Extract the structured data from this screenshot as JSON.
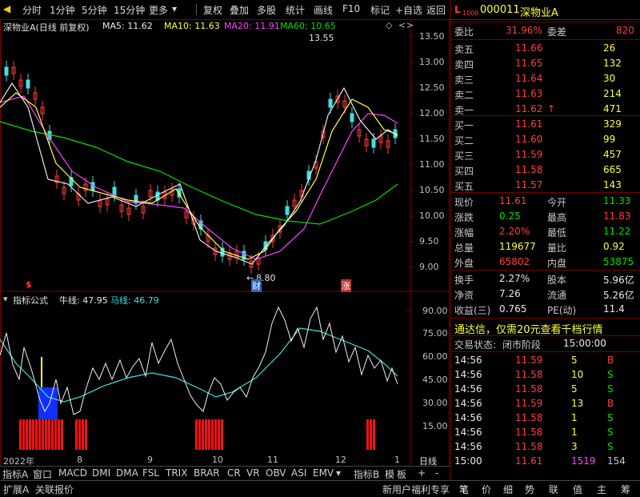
{
  "toolbar": {
    "items": [
      "分时",
      "1分钟",
      "5分钟",
      "15分钟",
      "更多",
      "复权",
      "叠加",
      "多股",
      "统计",
      "画线",
      "F10",
      "标记",
      "+自选",
      "返回"
    ]
  },
  "chart_header": {
    "name": "深物业A(日线 前复权)",
    "ma5": "MA5: 11.62",
    "ma10": "MA10: 11.63",
    "ma20": "MA20: 11.91",
    "ma60": "MA60: 10.65"
  },
  "price_axis": [
    "13.50",
    "13.00",
    "12.50",
    "12.00",
    "11.50",
    "11.00",
    "10.50",
    "10.00",
    "9.50",
    "9.00"
  ],
  "annotations": {
    "high": "13.55",
    "low": "8.80",
    "event1": "$",
    "event2": "财",
    "event3": "涨"
  },
  "indicator_header": {
    "name": "指标公式",
    "bull": "牛线: 47.95",
    "horse": "马线: 46.79"
  },
  "indicator_axis": [
    "90.00",
    "75.00",
    "60.00",
    "45.00",
    "30.00",
    "15.00"
  ],
  "date_axis": {
    "start": "2022年",
    "m8": "8",
    "m9": "9",
    "m10": "10",
    "m11": "11",
    "m12": "12",
    "m1": "1",
    "period": "日线"
  },
  "indicator_tabs": [
    "指标A",
    "窗口",
    "MACD",
    "DMI",
    "DMA",
    "FSL",
    "TRIX",
    "BRAR",
    "CR",
    "VR",
    "OBV",
    "ASI",
    "EMV",
    "指标B",
    "模",
    "板",
    "+",
    "-"
  ],
  "bottom_tabs": [
    "扩展A",
    "关联报价",
    "新用户福利专享",
    "笔",
    "价",
    "细",
    "势",
    "联",
    "值",
    "主",
    "筹"
  ],
  "colors": {
    "up": "#ff3c3c",
    "down": "#40e0e0",
    "ma5": "#e8e8e8",
    "ma10": "#ffff40",
    "ma20": "#ff40ff",
    "ma60": "#00e000",
    "panel_border": "#7a0000"
  },
  "stock": {
    "code": "000011",
    "name": "深物业A",
    "prefix": "L",
    "prefix_sub": "1000"
  },
  "weibi": {
    "label": "委比",
    "value": "31.96%",
    "label2": "委差",
    "value2": "820"
  },
  "asks": [
    {
      "label": "卖五",
      "price": "11.66",
      "vol": "26"
    },
    {
      "label": "卖四",
      "price": "11.65",
      "vol": "132"
    },
    {
      "label": "卖三",
      "price": "11.64",
      "vol": "30"
    },
    {
      "label": "卖二",
      "price": "11.63",
      "vol": "214"
    },
    {
      "label": "卖一",
      "price": "11.62",
      "vol": "471",
      "arrow": "↑"
    }
  ],
  "bids": [
    {
      "label": "买一",
      "price": "11.61",
      "vol": "329"
    },
    {
      "label": "买二",
      "price": "11.60",
      "vol": "99"
    },
    {
      "label": "买三",
      "price": "11.59",
      "vol": "457"
    },
    {
      "label": "买四",
      "price": "11.58",
      "vol": "665"
    },
    {
      "label": "买五",
      "price": "11.57",
      "vol": "143"
    }
  ],
  "quote": [
    {
      "l1": "现价",
      "v1": "11.61",
      "l2": "今开",
      "v2": "11.33"
    },
    {
      "l1": "涨跌",
      "v1": "0.25",
      "l2": "最高",
      "v2": "11.83"
    },
    {
      "l1": "涨幅",
      "v1": "2.20%",
      "l2": "最低",
      "v2": "11.22"
    },
    {
      "l1": "总量",
      "v1": "119677",
      "l2": "量比",
      "v2": "0.92"
    },
    {
      "l1": "外盘",
      "v1": "65802",
      "l2": "内盘",
      "v2": "53875"
    }
  ],
  "stats": [
    {
      "l1": "换手",
      "v1": "2.27%",
      "l2": "股本",
      "v2": "5.96亿"
    },
    {
      "l1": "净资",
      "v1": "7.26",
      "l2": "流通",
      "v2": "5.26亿"
    },
    {
      "l1": "收益(三)",
      "v1": "0.765",
      "l2": "PE(动)",
      "v2": "11.4"
    }
  ],
  "promo": "通达信，仅需20元查看千档行情",
  "trade_status": {
    "label": "交易状态:",
    "status": "闭市阶段",
    "time": "15:00:00"
  },
  "ticks": [
    {
      "time": "14:56",
      "price": "11.59",
      "vol": "5",
      "bs": "B"
    },
    {
      "time": "14:56",
      "price": "11.58",
      "vol": "10",
      "bs": "S"
    },
    {
      "time": "14:56",
      "price": "11.58",
      "vol": "5",
      "bs": "S"
    },
    {
      "time": "14:56",
      "price": "11.59",
      "vol": "13",
      "bs": "B"
    },
    {
      "time": "14:56",
      "price": "11.58",
      "vol": "1",
      "bs": "S"
    },
    {
      "time": "14:56",
      "price": "11.58",
      "vol": "1",
      "bs": "S"
    },
    {
      "time": "14:56",
      "price": "11.58",
      "vol": "3",
      "bs": "S"
    },
    {
      "time": "15:00",
      "price": "11.61",
      "vol": "1519",
      "bs": "154"
    }
  ]
}
